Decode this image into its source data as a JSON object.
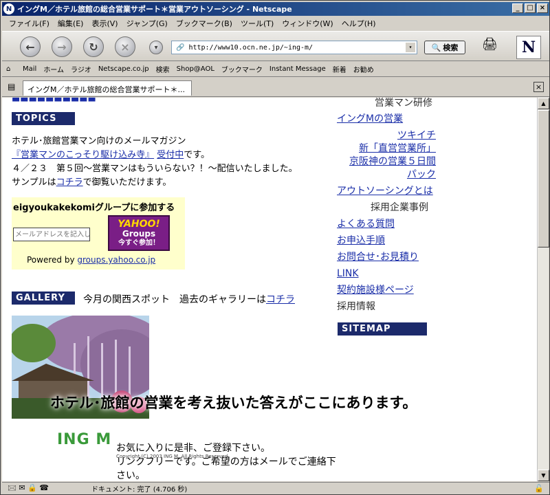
{
  "window": {
    "title": "イングM／ホテル旅館の総合営業サポート＊営業アウトソーシング - Netscape"
  },
  "menu": [
    "ファイル(F)",
    "編集(E)",
    "表示(V)",
    "ジャンプ(G)",
    "ブックマーク(B)",
    "ツール(T)",
    "ウィンドウ(W)",
    "ヘルプ(H)"
  ],
  "nav": {
    "url": "http://www10.ocn.ne.jp/~ing-m/",
    "search_label": "検索"
  },
  "bookmarks": [
    "Mail",
    "ホーム",
    "ラジオ",
    "Netscape.co.jp",
    "検索",
    "Shop@AOL",
    "ブックマーク",
    "Instant Message",
    "新着",
    "お勧め"
  ],
  "tab": {
    "label": "イングM／ホテル旅館の総合営業サポート＊..."
  },
  "page": {
    "topics_label": "TOPICS",
    "topics_line1": "ホテル･旅館営業マン向けのメールマガジン",
    "topics_mag_title": "『営業マンのこっそり駆け込み寺』",
    "topics_mag_link": "受付中",
    "topics_mag_suffix": "です。",
    "topics_line3": "４／２３　第５回～営業マンはもういらない？！～配信いたしました。",
    "topics_line4_pre": "サンプルは",
    "topics_line4_link": "コチラ",
    "topics_line4_post": "で御覧いただけます。",
    "group_title": "eigyoukakekomiグループに参加する",
    "group_input_placeholder": "メールアドレスを記入してください",
    "yahoo_top": "YAHOO!",
    "yahoo_mid": "Groups",
    "yahoo_bot": "今すぐ参加！",
    "powered_by": "Powered by",
    "powered_link": "groups.yahoo.co.jp",
    "gallery_label": "GALLERY",
    "gallery_text": "今月の関西スポット　過去のギャラリーは",
    "gallery_link": "コチラ",
    "banner_text": "ホテル･旅館の営業を考え抜いた答えがここにあります。",
    "logo_text": "ING M",
    "footer_line1": "お気に入りに是非、ご登録下さい。",
    "footer_line2": "リンクフリーです。ご希望の方はメールでご連絡下さい。",
    "copyright": "Copyright (C) 2003 ING M. All Rights Reserved.",
    "side_top": "営業マン研修",
    "side_items": [
      "イングMの営業",
      "ツキイチ",
      "新「直営営業所」",
      "京阪神の営業５日間",
      "パック",
      "アウトソーシングとは",
      "採用企業事例",
      "よくある質問",
      "お申込手順",
      "お問合せ･お見積り",
      "LINK",
      "契約施設様ページ",
      "採用情報"
    ],
    "sitemap_label": "SITEMAP"
  },
  "status": {
    "text": "ドキュメント: 完了 (4.706 秒)"
  }
}
